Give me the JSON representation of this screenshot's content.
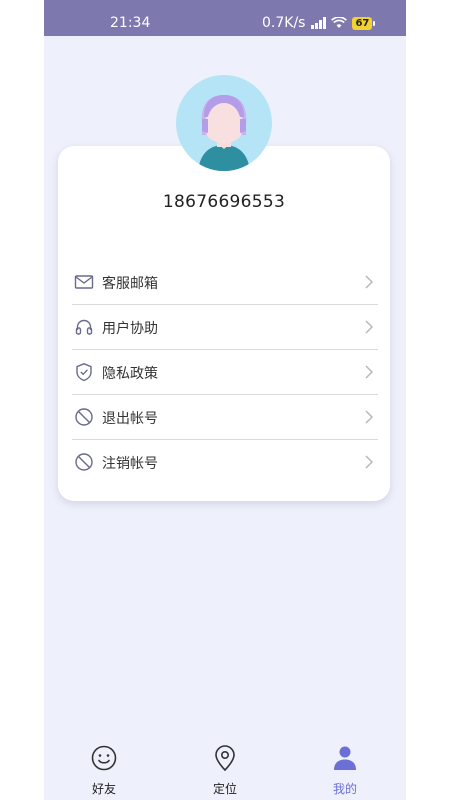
{
  "status_bar": {
    "time": "21:34",
    "network_speed": "0.7K/s",
    "battery": "67"
  },
  "profile": {
    "phone_number": "18676696553"
  },
  "menu": {
    "items": [
      {
        "label": "客服邮箱",
        "icon": "mail-icon"
      },
      {
        "label": "用户协助",
        "icon": "headphones-icon"
      },
      {
        "label": "隐私政策",
        "icon": "shield-check-icon"
      },
      {
        "label": "退出帐号",
        "icon": "prohibited-icon"
      },
      {
        "label": "注销帐号",
        "icon": "prohibited-icon"
      }
    ]
  },
  "tabbar": {
    "tabs": [
      {
        "label": "好友",
        "icon": "smiley-icon",
        "active": false
      },
      {
        "label": "定位",
        "icon": "location-pin-icon",
        "active": false
      },
      {
        "label": "我的",
        "icon": "user-icon",
        "active": true
      }
    ]
  },
  "colors": {
    "status_bar": "#7d78ad",
    "background": "#eef0fb",
    "accent": "#6b6fd6",
    "avatar_bg": "#b6e4f7"
  }
}
